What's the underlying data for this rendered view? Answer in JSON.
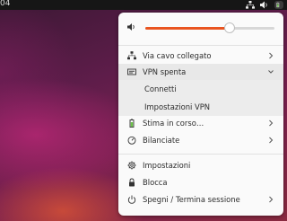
{
  "topbar": {
    "clock": "04"
  },
  "menu": {
    "volume": {
      "level": 0.65,
      "icon": "speaker-icon"
    },
    "items": [
      {
        "label": "Via cavo collegato",
        "icon": "network-wired-icon"
      },
      {
        "label": "VPN spenta",
        "icon": "vpn-icon"
      },
      {
        "label": "Connetti"
      },
      {
        "label": "Impostazioni VPN"
      },
      {
        "label": "Stima in corso…",
        "icon": "battery-icon"
      },
      {
        "label": "Bilanciate",
        "icon": "power-profile-icon"
      },
      {
        "label": "Impostazioni",
        "icon": "settings-icon"
      },
      {
        "label": "Blocca",
        "icon": "lock-icon"
      },
      {
        "label": "Spegni / Termina sessione",
        "icon": "power-icon"
      }
    ]
  },
  "colors": {
    "accent": "#e95420",
    "menu_bg": "#fafafa",
    "topbar_bg": "#161616"
  }
}
